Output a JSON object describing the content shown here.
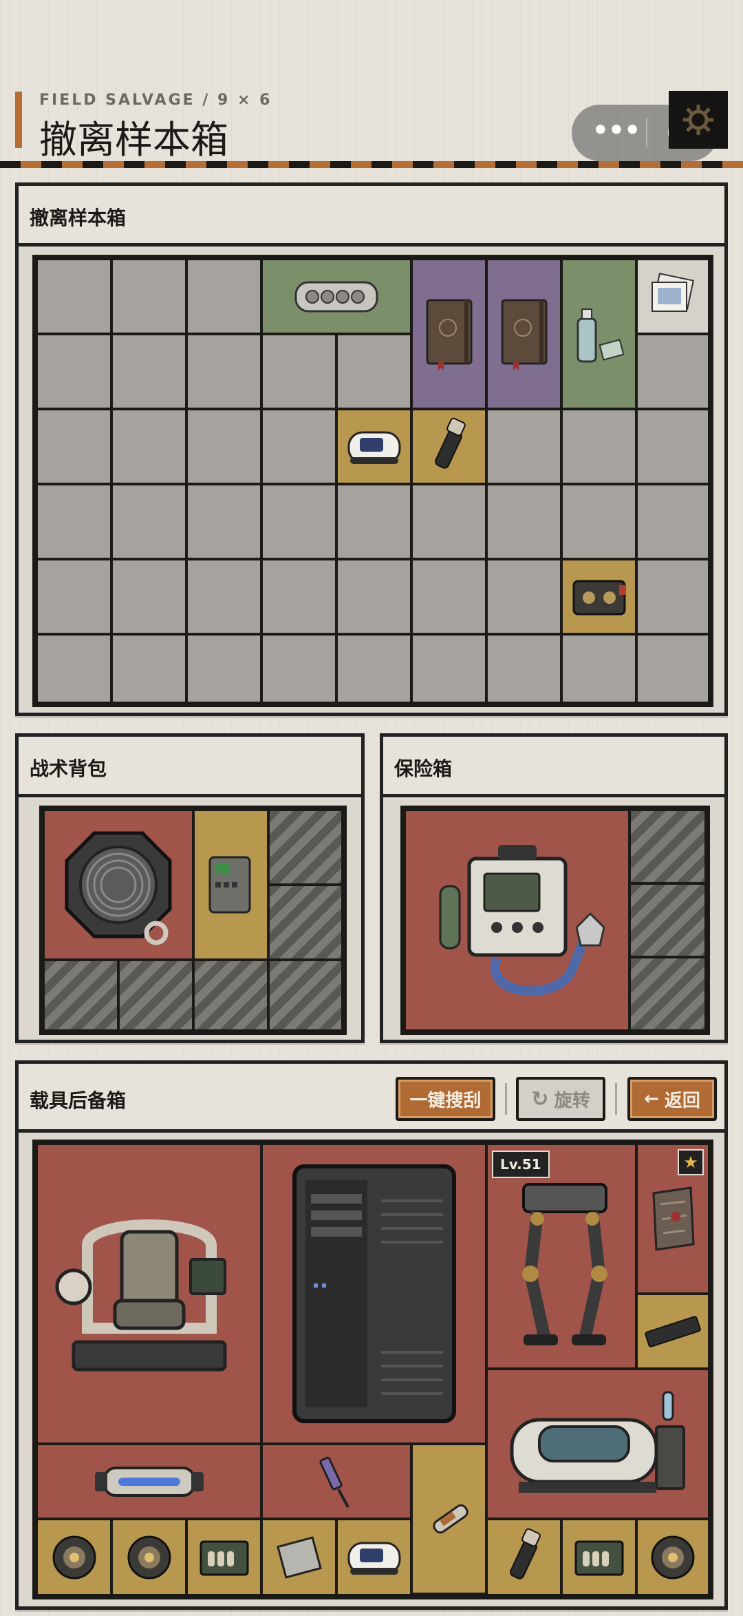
{
  "header": {
    "subtitle": "FIELD SALVAGE / 9 × 6",
    "title": "撤离样本箱",
    "capsule_more_icon": "more-dots-icon",
    "capsule_close_icon": "target-circle-icon",
    "settings_icon": "gear-icon"
  },
  "sample_box": {
    "title": "撤离样本箱",
    "columns": 9,
    "rows": 6,
    "items": [
      {
        "name": "bead-bracelet",
        "icon": "bead-case-icon",
        "color": "green"
      },
      {
        "name": "journal-1",
        "icon": "notebook-icon",
        "color": "purple"
      },
      {
        "name": "journal-2",
        "icon": "notebook-icon",
        "color": "purple"
      },
      {
        "name": "spray-bottle",
        "icon": "spray-bottle-icon",
        "color": "green"
      },
      {
        "name": "photos",
        "icon": "photo-stack-icon",
        "color": "white"
      },
      {
        "name": "oximeter",
        "icon": "pulse-oximeter-icon",
        "color": "gold"
      },
      {
        "name": "flashlight",
        "icon": "flashlight-icon",
        "color": "gold"
      },
      {
        "name": "cassette-case",
        "icon": "cassette-icon",
        "color": "gold"
      }
    ]
  },
  "backpack": {
    "title": "战术背包",
    "items": [
      {
        "name": "cable-reel",
        "icon": "cable-reel-icon",
        "color": "red"
      },
      {
        "name": "router",
        "icon": "router-icon",
        "color": "gold"
      }
    ]
  },
  "safe_box": {
    "title": "保险箱",
    "items": [
      {
        "name": "ventilator",
        "icon": "ventilator-icon",
        "color": "red"
      }
    ]
  },
  "vehicle_trunk": {
    "title": "载具后备箱",
    "buttons": {
      "loot_all": "一键搜刮",
      "rotate": "旋转",
      "back": "返回"
    },
    "level_badge": "Lv.51",
    "items": [
      {
        "name": "command-chair",
        "icon": "chair-icon",
        "color": "red"
      },
      {
        "name": "server-tower",
        "icon": "server-tower-icon",
        "color": "red"
      },
      {
        "name": "exo-legs",
        "icon": "exoskeleton-icon",
        "color": "red"
      },
      {
        "name": "map-parchment",
        "icon": "map-scroll-icon",
        "color": "red"
      },
      {
        "name": "ram-stick",
        "icon": "ram-stick-icon",
        "color": "gold"
      },
      {
        "name": "capsule-bed",
        "icon": "capsule-bed-icon",
        "color": "red"
      },
      {
        "name": "battery-cell",
        "icon": "battery-cell-icon",
        "color": "red"
      },
      {
        "name": "syringe-tool",
        "icon": "syringe-icon",
        "color": "red"
      },
      {
        "name": "injector",
        "icon": "injector-icon",
        "color": "gold"
      },
      {
        "name": "lantern-1",
        "icon": "lantern-icon",
        "color": "gold"
      },
      {
        "name": "lantern-2",
        "icon": "lantern-icon",
        "color": "gold"
      },
      {
        "name": "ammo-crate-1",
        "icon": "ammo-crate-icon",
        "color": "gold"
      },
      {
        "name": "cpu-chip",
        "icon": "cpu-chip-icon",
        "color": "gold"
      },
      {
        "name": "oximeter-2",
        "icon": "pulse-oximeter-icon",
        "color": "gold"
      },
      {
        "name": "flashlight-2",
        "icon": "flashlight-icon",
        "color": "gold"
      },
      {
        "name": "ammo-crate-2",
        "icon": "ammo-crate-icon",
        "color": "gold"
      },
      {
        "name": "lantern-3",
        "icon": "lantern-icon",
        "color": "gold"
      }
    ]
  },
  "colors": {
    "accent": "#b56e35",
    "rarity_red": "#a0544a",
    "rarity_gold": "#b8984f",
    "rarity_purple": "#7f6e8f",
    "rarity_green": "#7a8f6a",
    "rarity_white": "#d6d2c9",
    "empty_cell": "#a6a39e"
  }
}
